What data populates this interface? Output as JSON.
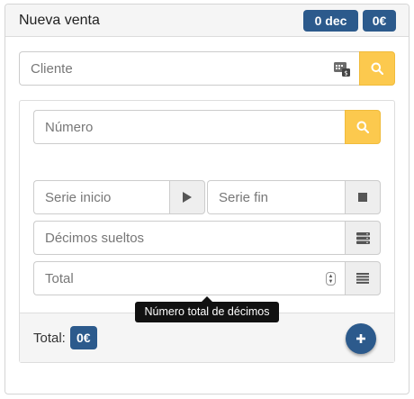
{
  "header": {
    "title": "Nueva venta",
    "decimos_badge": "0 dec",
    "amount_badge": "0€"
  },
  "cliente": {
    "placeholder": "Cliente"
  },
  "numero": {
    "placeholder": "Número"
  },
  "serie_inicio": {
    "placeholder": "Serie inicio"
  },
  "serie_fin": {
    "placeholder": "Serie fin"
  },
  "decimos_sueltos": {
    "placeholder": "Décimos sueltos"
  },
  "total_input": {
    "placeholder": "Total"
  },
  "tooltip": {
    "text": "Número total de décimos"
  },
  "footer": {
    "total_label": "Total:",
    "total_value": "0€"
  },
  "colors": {
    "accent": "#2c5a8c",
    "search": "#fcc94e"
  }
}
